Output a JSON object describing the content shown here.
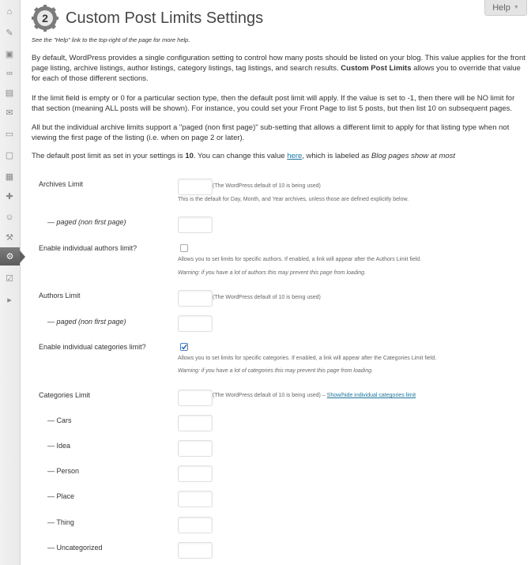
{
  "help": {
    "label": "Help"
  },
  "sidebar": {
    "items": [
      {
        "name": "dashboard-icon",
        "glyph": "⌂"
      },
      {
        "name": "pin-icon",
        "glyph": "✎"
      },
      {
        "name": "media-icon",
        "glyph": "▣"
      },
      {
        "name": "links-icon",
        "glyph": "∞"
      },
      {
        "name": "pages-icon",
        "glyph": "▤"
      },
      {
        "name": "comments-icon",
        "glyph": "✉"
      },
      {
        "name": "feedback-icon",
        "glyph": "▭"
      },
      {
        "name": "ratings-icon",
        "glyph": "▢"
      },
      {
        "name": "appearance-icon",
        "glyph": "▦"
      },
      {
        "name": "plugins-icon",
        "glyph": "✚"
      },
      {
        "name": "users-icon",
        "glyph": "☺"
      },
      {
        "name": "tools-icon",
        "glyph": "⚒"
      },
      {
        "name": "settings-icon",
        "glyph": "⚙"
      },
      {
        "name": "extra-icon",
        "glyph": "☑"
      },
      {
        "name": "collapse-icon",
        "glyph": "▸"
      }
    ]
  },
  "page": {
    "title": "Custom Post Limits Settings",
    "help_note": "See the \"Help\" link to the top-right of the page for more help.",
    "intro_1": "By default, WordPress provides a single configuration setting to control how many posts should be listed on your blog. This value applies for the front page listing, archive listings, author listings, category listings, tag listings, and search results.",
    "intro_1_bold": "Custom Post Limits",
    "intro_1_end": "allows you to override that value for each of those different sections.",
    "intro_2": "If the limit field is empty or 0 for a particular section type, then the default post limit will apply. If the value is set to -1, then there will be NO limit for that section (meaning ALL posts will be shown). For instance, you could set your Front Page to list 5 posts, but then list 10 on subsequent pages.",
    "intro_3": "All but the individual archive limits support a \"paged (non first page)\" sub-setting that allows a different limit to apply for that listing type when not viewing the first page of the listing (i.e. when on page 2 or later).",
    "intro_4_pre": "The default post limit as set in your settings is",
    "intro_4_value": "10",
    "intro_4_mid": ". You can change this value",
    "intro_4_link": "here",
    "intro_4_post": ", which is labeled as",
    "intro_4_italic": "Blog pages show at most"
  },
  "form": {
    "archives_label": "Archives Limit",
    "archives_value": "",
    "default_note": "(The WordPress default of 10 is being used)",
    "archives_desc": "This is the default for Day, Month, and Year archives, unless those are defined explicitly below.",
    "paged_label": "— paged (non first page)",
    "authors_enable_label": "Enable individual authors limit?",
    "authors_enable_checked": false,
    "authors_enable_desc": "Allows you to set limits for specific authors. If enabled, a link will appear after the Authors Limit field.",
    "authors_enable_warn": "Warning: if you have a lot of authors this may prevent this page from loading.",
    "authors_label": "Authors Limit",
    "categories_enable_label": "Enable individual categories limit?",
    "categories_enable_checked": true,
    "categories_enable_desc": "Allows you to set limits for specific categories. If enabled, a link will appear after the Categories Limit field.",
    "categories_enable_warn": "Warning: if you have a lot of categories this may prevent this page from loading.",
    "categories_label": "Categories Limit",
    "categories_note_sep": "–",
    "categories_toggle_link": "Show/hide individual categories limit",
    "categories": [
      {
        "label": "— Cars"
      },
      {
        "label": "— Idea"
      },
      {
        "label": "— Person"
      },
      {
        "label": "— Place"
      },
      {
        "label": "— Thing"
      },
      {
        "label": "— Uncategorized"
      }
    ]
  },
  "colors": {
    "link": "#21759b",
    "accent": "#4a7fc0",
    "active_menu": "#6a6a6a"
  }
}
